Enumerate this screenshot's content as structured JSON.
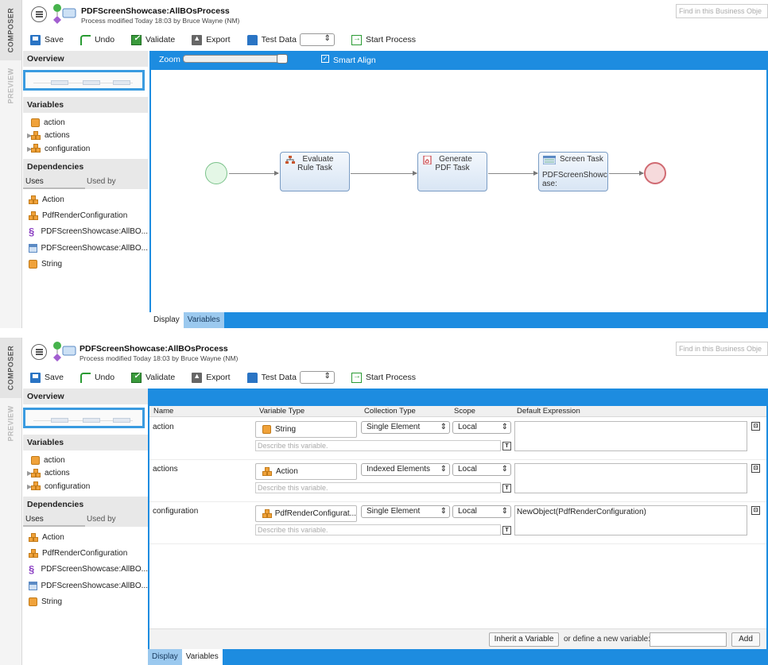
{
  "rail": {
    "composer": "COMPOSER",
    "preview": "PREVIEW"
  },
  "header": {
    "title": "PDFScreenShowcase:AllBOsProcess",
    "subtitle": "Process modified Today 18:03 by Bruce Wayne (NM)",
    "find_placeholder": "Find in this Business Obje"
  },
  "toolbar": {
    "save": "Save",
    "undo": "Undo",
    "validate": "Validate",
    "export": "Export",
    "test_data": "Test Data",
    "start_process": "Start Process"
  },
  "sidebar": {
    "overview": "Overview",
    "variables_title": "Variables",
    "variables": [
      {
        "name": "action",
        "icon": "cube-icon",
        "expandable": false
      },
      {
        "name": "actions",
        "icon": "cubes-icon",
        "expandable": true
      },
      {
        "name": "configuration",
        "icon": "cubes-icon",
        "expandable": true
      }
    ],
    "dependencies_title": "Dependencies",
    "tab_uses": "Uses",
    "tab_used_by": "Used by",
    "dependencies": [
      {
        "name": "Action",
        "icon": "cubes-icon"
      },
      {
        "name": "PdfRenderConfiguration",
        "icon": "cubes-icon"
      },
      {
        "name": "PDFScreenShowcase:AllBO...",
        "icon": "script-icon"
      },
      {
        "name": "PDFScreenShowcase:AllBO...",
        "icon": "form-icon"
      },
      {
        "name": "String",
        "icon": "cube-icon"
      }
    ]
  },
  "canvas": {
    "zoom_label": "Zoom",
    "smart_align": "Smart Align",
    "smart_align_checked": true,
    "tasks": [
      {
        "line1": "Evaluate",
        "line2": "Rule Task"
      },
      {
        "line1": "Generate",
        "line2": "PDF Task"
      },
      {
        "line1": "Screen Task",
        "line2": "PDFScreenShowc",
        "line3": "ase:"
      }
    ],
    "tab_display": "Display",
    "tab_variables": "Variables"
  },
  "grid": {
    "columns": [
      "Name",
      "Variable Type",
      "Collection Type",
      "Scope",
      "Default Expression"
    ],
    "desc_placeholder": "Describe this variable.",
    "rows": [
      {
        "name": "action",
        "type": "String",
        "type_icon": "cube-icon",
        "collection": "Single Element",
        "scope": "Local",
        "expression": ""
      },
      {
        "name": "actions",
        "type": "Action",
        "type_icon": "cubes-icon",
        "collection": "Indexed Elements",
        "scope": "Local",
        "expression": ""
      },
      {
        "name": "configuration",
        "type": "PdfRenderConfigurat...",
        "type_icon": "cubes-icon",
        "collection": "Single Element",
        "scope": "Local",
        "expression": "NewObject(PdfRenderConfiguration)"
      }
    ],
    "inherit_button": "Inherit a Variable",
    "define_label": "or define a new variable:",
    "add_button": "Add"
  }
}
